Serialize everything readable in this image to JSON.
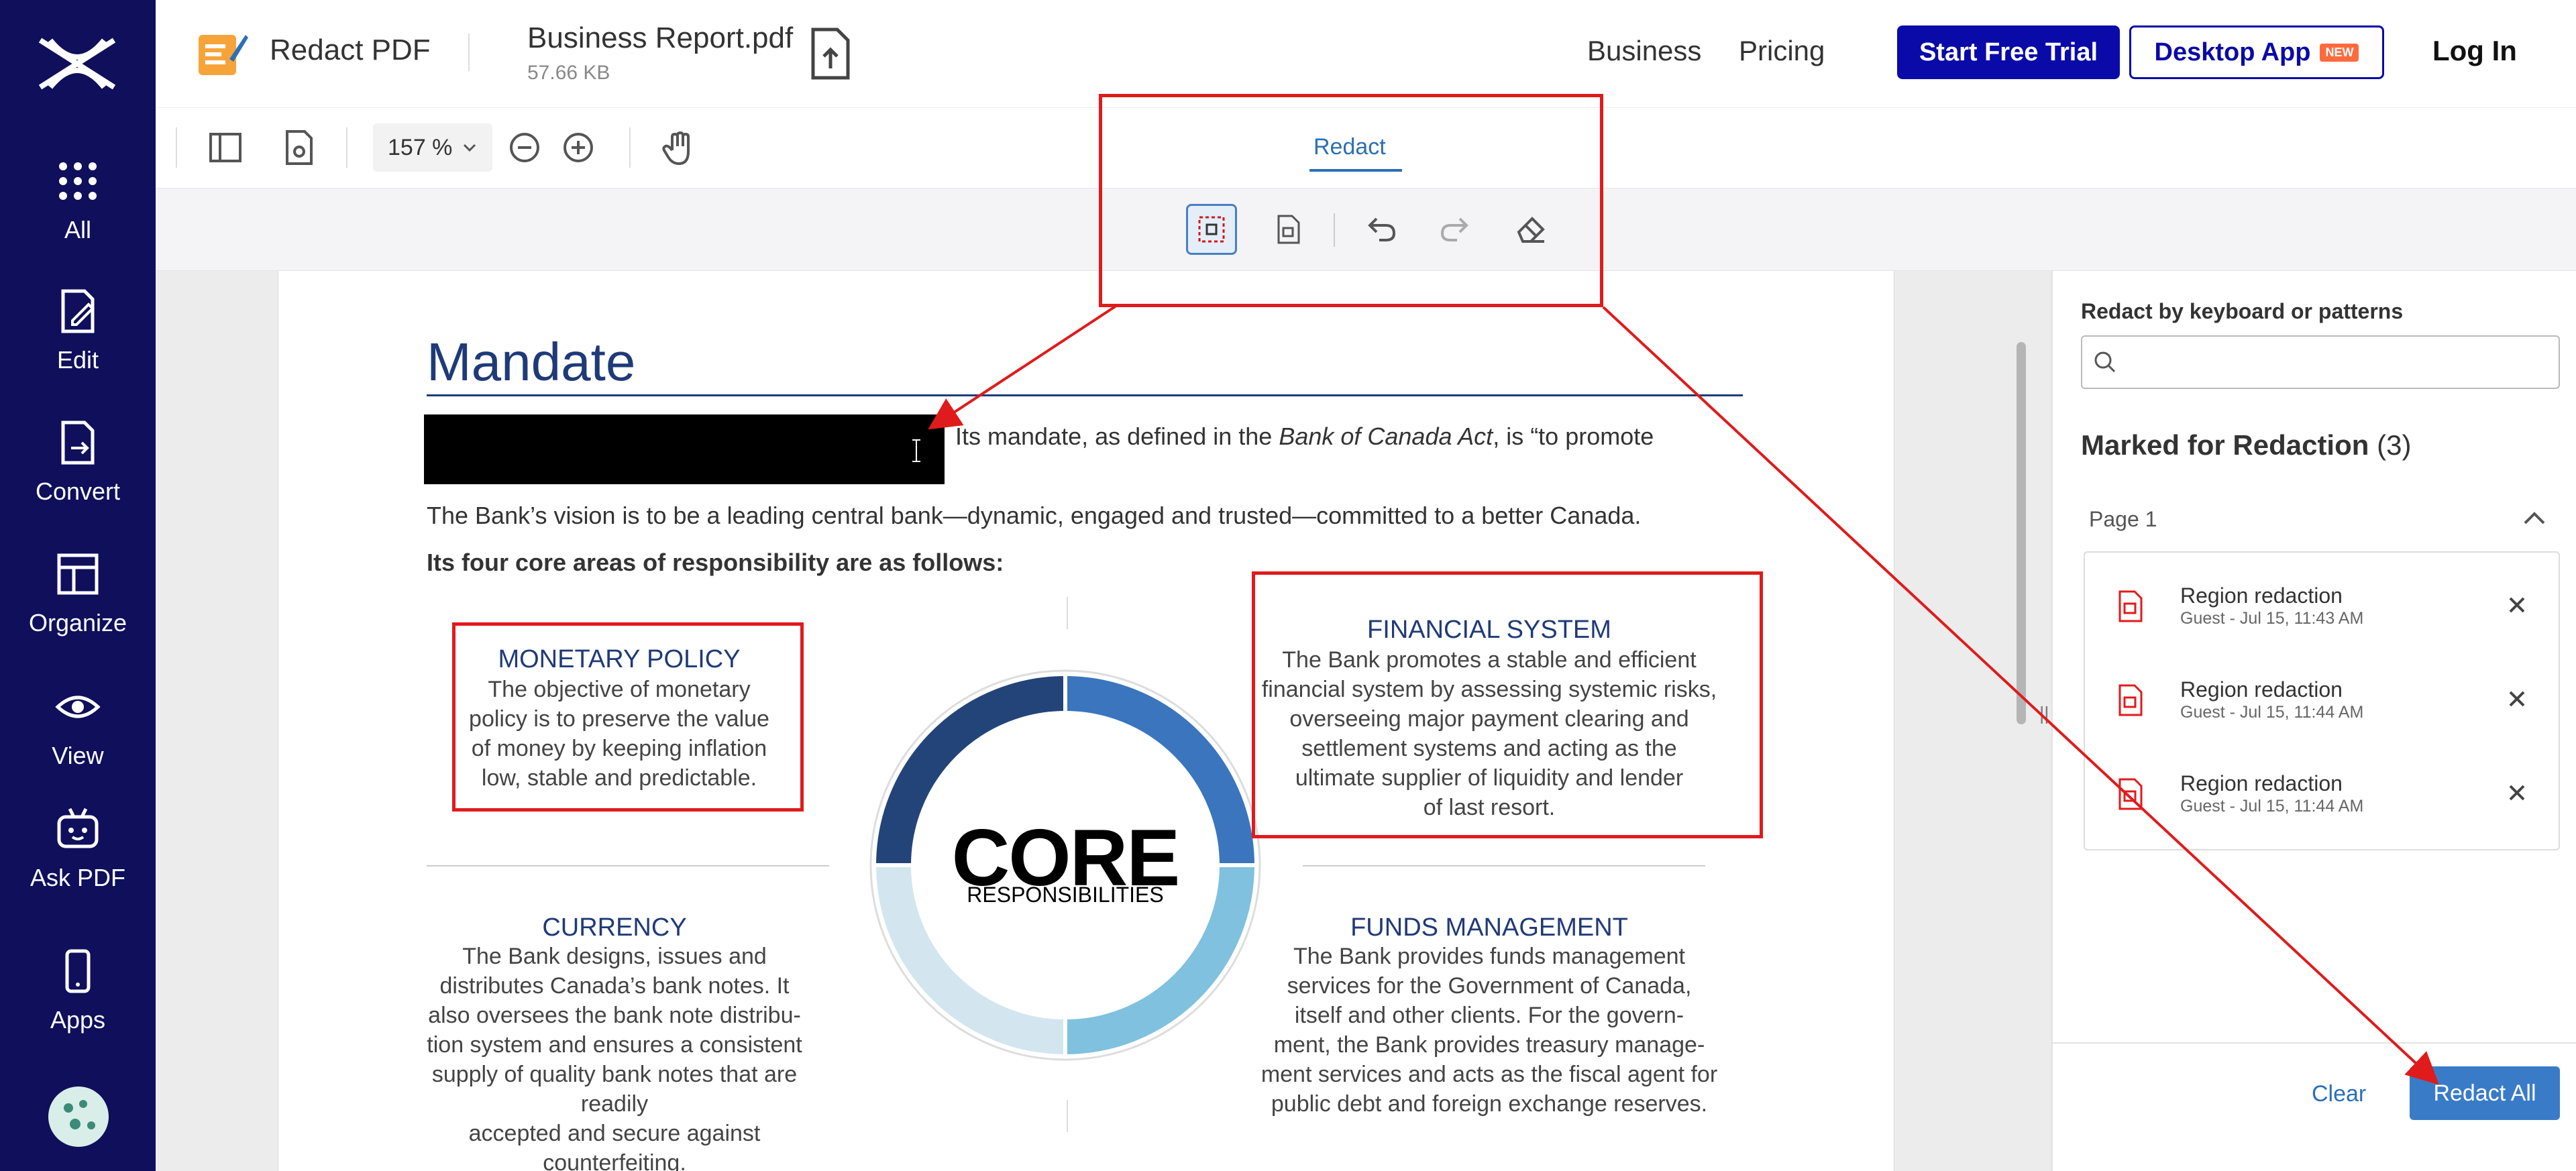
{
  "rail": {
    "items": [
      {
        "label": "All",
        "icon": "grid-icon"
      },
      {
        "label": "Edit",
        "icon": "edit-icon"
      },
      {
        "label": "Convert",
        "icon": "convert-icon"
      },
      {
        "label": "Organize",
        "icon": "organize-icon"
      },
      {
        "label": "View",
        "icon": "eye-icon"
      },
      {
        "label": "Ask PDF",
        "icon": "robot-icon"
      },
      {
        "label": "Apps",
        "icon": "phone-icon"
      }
    ]
  },
  "header": {
    "app_name": "Redact PDF",
    "file_name": "Business Report.pdf",
    "file_size": "57.66 KB",
    "nav": [
      "Business",
      "Pricing"
    ],
    "trial_label": "Start Free Trial",
    "desktop_label": "Desktop App",
    "new_badge": "NEW",
    "login_label": "Log In"
  },
  "toolbar": {
    "zoom": "157 %",
    "active_tab": "Redact"
  },
  "document": {
    "title": "Mandate",
    "line1_pre": "Its mandate, as defined in the ",
    "line1_italic": "Bank of Canada Act",
    "line1_post": ", is “to promote",
    "line2": "The Bank’s vision is to be a leading central bank—dynamic, engaged and trusted—committed to a better Canada.",
    "line3": "Its four core areas of responsibility are as follows:",
    "core_title": "CORE",
    "core_sub": "RESPONSIBILITIES",
    "sections": {
      "monetary": {
        "heading": "MONETARY POLICY",
        "lines": [
          "The objective of monetary",
          "policy is to preserve the value",
          "of money by keeping inflation",
          "low, stable and predictable."
        ]
      },
      "financial": {
        "heading": "FINANCIAL SYSTEM",
        "lines": [
          "The Bank promotes a stable and efficient",
          "financial system by assessing systemic risks,",
          "overseeing major payment clearing and",
          "settlement systems and acting as the",
          "ultimate supplier of liquidity and lender",
          "of  last resort."
        ]
      },
      "currency": {
        "heading": "CURRENCY",
        "lines": [
          "The Bank designs, issues and",
          "distributes Canada’s bank notes. It",
          "also oversees the bank note distribu-",
          "tion system and ensures a consistent",
          "supply of quality bank notes that are readily",
          "accepted and secure against counterfeiting."
        ]
      },
      "funds": {
        "heading": "FUNDS MANAGEMENT",
        "lines": [
          "The Bank provides funds management",
          "services for the Government of Canada,",
          "itself and other clients. For the govern-",
          "ment, the Bank provides treasury manage-",
          "ment services and acts as the fiscal agent for",
          "public debt and foreign exchange reserves."
        ]
      }
    }
  },
  "panel": {
    "search_label": "Redact by keyboard or patterns",
    "search_placeholder": "",
    "marked_title": "Marked for Redaction",
    "marked_count": "(3)",
    "page_label": "Page 1",
    "items": [
      {
        "title": "Region redaction",
        "sub": "Guest - Jul 15, 11:43 AM"
      },
      {
        "title": "Region redaction",
        "sub": "Guest - Jul 15, 11:44 AM"
      },
      {
        "title": "Region redaction",
        "sub": "Guest - Jul 15, 11:44 AM"
      }
    ],
    "clear_label": "Clear",
    "redact_all_label": "Redact All"
  },
  "colors": {
    "rail_bg": "#0f0f5c",
    "primary_blue": "#0a0aa8",
    "accent_blue": "#2c6fb7",
    "annotation_red": "#e01b1b",
    "doc_navy": "#1f3a78"
  }
}
